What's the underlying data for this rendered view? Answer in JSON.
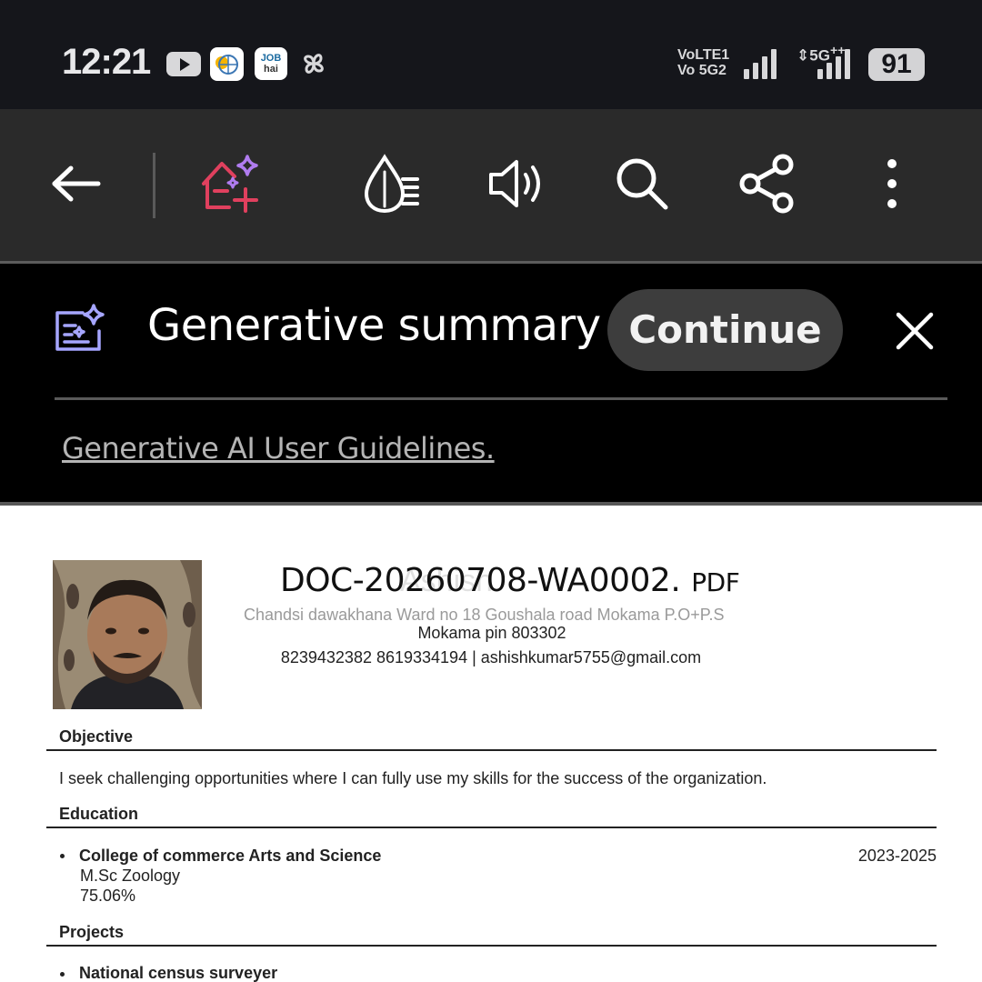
{
  "status_bar": {
    "time": "12:21",
    "app_icons": [
      "youtube-icon",
      "weather-app-icon",
      "jobhai-app-icon",
      "pinwheel-app-icon"
    ],
    "jobhai_label_1": "JOB",
    "jobhai_label_2": "hai",
    "network_line1": "VoLTE1",
    "network_line2": "Vo 5G2",
    "network_5g": "5G",
    "battery": "91"
  },
  "toolbar": {
    "buttons": [
      "back-arrow-icon",
      "ai-assistant-icon",
      "reading-mode-icon",
      "read-aloud-icon",
      "search-icon",
      "share-icon",
      "more-options-icon"
    ],
    "accent_color": "#e0405e"
  },
  "summary": {
    "title": "Generative summary",
    "continue_label": "Continue",
    "guidelines_link": "Generative AI User Guidelines.",
    "icon_color": "#a6a6ff"
  },
  "document": {
    "title": "DOC-20260708-WA0002.",
    "title_ext": "PDF",
    "address_line1": "Chandsi dawakhana Ward no 18 Goushala road Mokama P.O+P.S",
    "address_line2": "Mokama pin 803302",
    "contact": "8239432382 8619334194  |  ashishkumar5755@gmail.com",
    "sections": {
      "objective": {
        "heading": "Objective",
        "text": "I seek challenging opportunities where I can fully use my skills for the success of the organization."
      },
      "education": {
        "heading": "Education",
        "entries": [
          {
            "title": "College of commerce Arts and Science",
            "date": "2023-2025",
            "degree": "M.Sc Zoology",
            "score": "75.06%"
          }
        ]
      },
      "projects": {
        "heading": "Projects",
        "entries": [
          {
            "title": "National census surveyer"
          }
        ]
      }
    }
  }
}
